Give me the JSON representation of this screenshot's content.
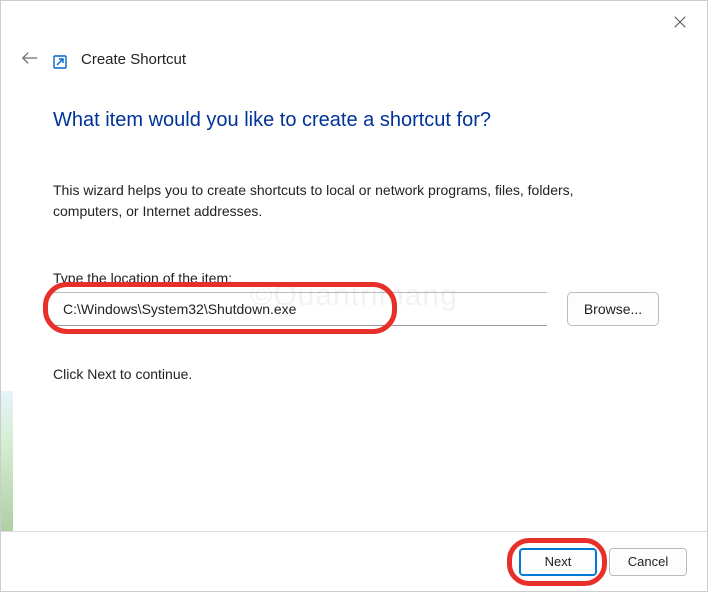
{
  "header": {
    "title": "Create Shortcut"
  },
  "heading": "What item would you like to create a shortcut for?",
  "description": "This wizard helps you to create shortcuts to local or network programs, files, folders, computers, or Internet addresses.",
  "field": {
    "label": "Type the location of the item:",
    "value": "C:\\Windows\\System32\\Shutdown.exe"
  },
  "buttons": {
    "browse": "Browse...",
    "next": "Next",
    "cancel": "Cancel"
  },
  "continue_hint": "Click Next to continue.",
  "watermark": "©Quantrimang"
}
